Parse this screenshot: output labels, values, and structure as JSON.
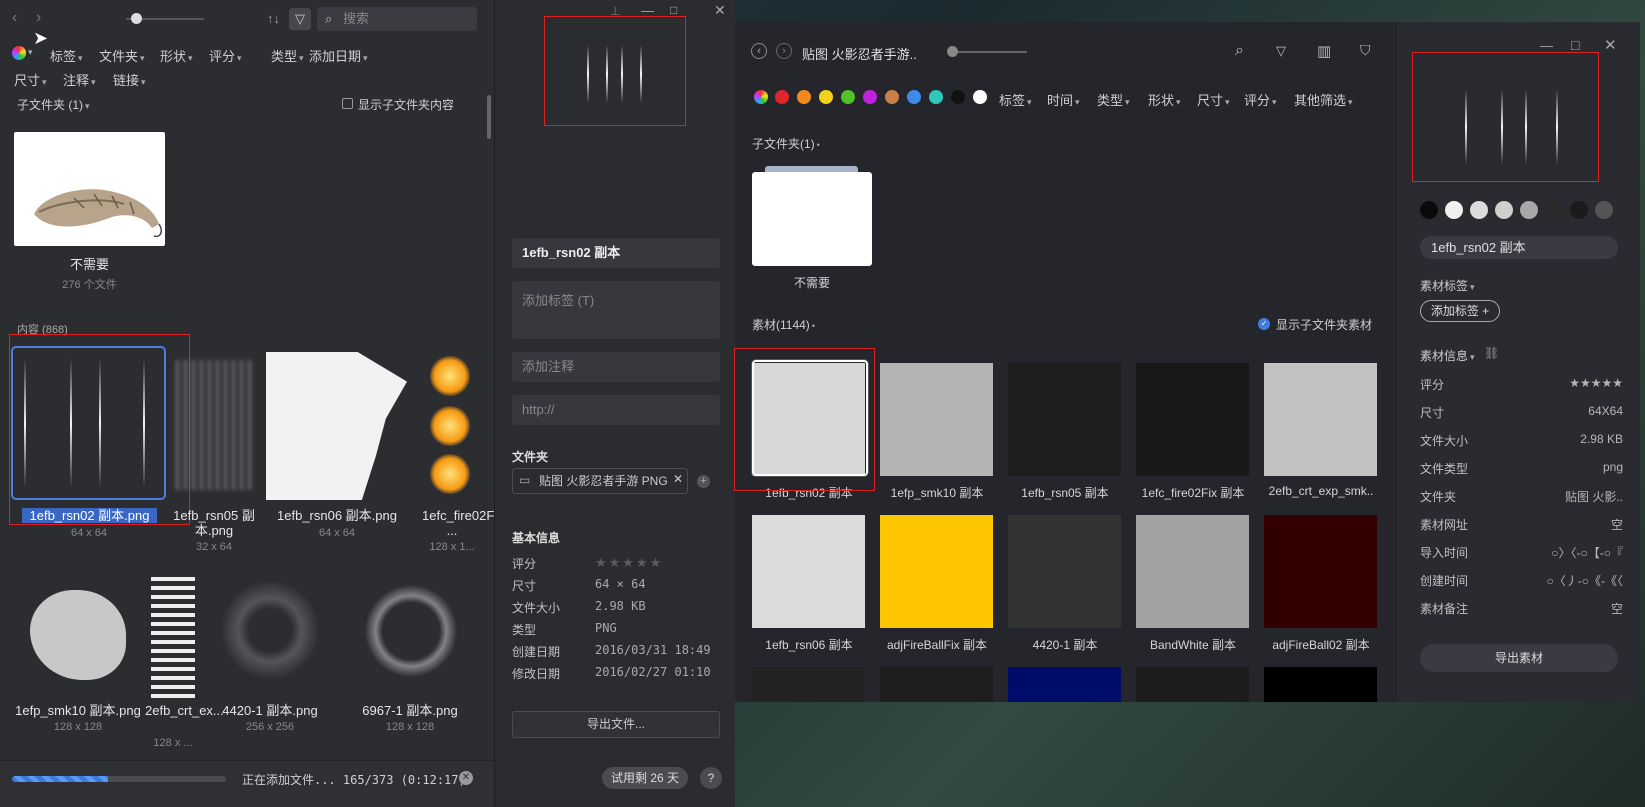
{
  "left_app": {
    "toolbar": {
      "back_icon": "chevron-left-icon",
      "forward_icon": "chevron-right-icon",
      "search_placeholder": "搜索"
    },
    "filters_row1": [
      "标签",
      "文件夹",
      "形状",
      "评分",
      "类型",
      "添加日期"
    ],
    "filters_row2": [
      "尺寸",
      "注释",
      "链接"
    ],
    "subfolder_header": "子文件夹 (1)",
    "show_subfolder_content": "显示子文件夹内容",
    "folder": {
      "name": "不需要",
      "count": "276 个文件"
    },
    "content_header": "内容 (868)",
    "items": [
      {
        "name": "1efb_rsn02 副本.png",
        "size": "64 x 64"
      },
      {
        "name": "1efb_rsn05 副本.png",
        "size": "32 x 64"
      },
      {
        "name": "1efb_rsn06 副本.png",
        "size": "64 x 64"
      },
      {
        "name": "1efc_fire02Fix ...",
        "size": "128 x 1..."
      },
      {
        "name": "1efp_smk10 副本.png",
        "size": "128 x 128"
      },
      {
        "name": "2efb_crt_ex...",
        "size": "128 x ..."
      },
      {
        "name": "4420-1 副本.png",
        "size": "256 x 256"
      },
      {
        "name": "6967-1 副本.png",
        "size": "128 x 128"
      }
    ],
    "status": {
      "text": "正在添加文件... 165/373 (0:12:17)",
      "progress": 0.45
    }
  },
  "detail": {
    "name": "1efb_rsn02 副本",
    "tag_placeholder": "添加标签 (T)",
    "note_placeholder": "添加注释",
    "url_placeholder": "http://",
    "folder_label": "文件夹",
    "folder_value": "贴图 火影忍者手游 PNG",
    "basic_info": "基本信息",
    "rows": [
      {
        "k": "评分",
        "v": ""
      },
      {
        "k": "尺寸",
        "v": "64 × 64"
      },
      {
        "k": "文件大小",
        "v": "2.98 KB"
      },
      {
        "k": "类型",
        "v": "PNG"
      },
      {
        "k": "创建日期",
        "v": "2016/03/31 18:49"
      },
      {
        "k": "修改日期",
        "v": "2016/02/27 01:10"
      }
    ],
    "export": "导出文件...",
    "trial": "试用剩 26 天",
    "help": "?"
  },
  "right_app": {
    "title": "贴图 火影忍者手游..",
    "filters": [
      "标签",
      "时间",
      "类型",
      "形状",
      "尺寸",
      "评分",
      "其他筛选"
    ],
    "colors": [
      "#e0262b",
      "#f08a1c",
      "#f0d21c",
      "#52c22a",
      "#c020e0",
      "#c8814a",
      "#3f8ae8",
      "#2fc8b8",
      "#111111",
      "#ffffff"
    ],
    "subfolder_header": "子文件夹(1)",
    "folder_name": "不需要",
    "materials_header": "素材(1144)",
    "show_sub_materials": "显示子文件夹素材",
    "tiles": [
      {
        "name": "1efb_rsn02 副本",
        "color": "#d8d8d8"
      },
      {
        "name": "1efp_smk10 副本",
        "color": "#b4b4b4"
      },
      {
        "name": "1efb_rsn05 副本",
        "color": "#1e1e1e"
      },
      {
        "name": "1efc_fire02Fix 副本",
        "color": "#181818"
      },
      {
        "name": "2efb_crt_exp_smk..",
        "color": "#c2c2c2"
      },
      {
        "name": "1efb_rsn06 副本",
        "color": "#dcdcdc"
      },
      {
        "name": "adjFireBallFix 副本",
        "color": "#fdc600"
      },
      {
        "name": "4420-1 副本",
        "color": "#333333"
      },
      {
        "name": "BandWhite 副本",
        "color": "#a2a2a2"
      },
      {
        "name": "adjFireBall02 副本",
        "color": "#330000"
      }
    ],
    "bottom_tiles": [
      "#222222",
      "#1e1e1e",
      "#000c6a",
      "#1c1c1c",
      "#000000"
    ]
  },
  "inspector": {
    "swatches": [
      "#0a0a0a",
      "#f0f0f0",
      "#dcdcdc",
      "#cfcfcf",
      "#a8a8a8",
      "#2a2a2a",
      "#1a1a1a",
      "#555555"
    ],
    "name": "1efb_rsn02 副本",
    "tags_label": "素材标签",
    "add_tag": "添加标签 +",
    "info_label": "素材信息",
    "rows": [
      {
        "k": "评分",
        "v": "★★★★★"
      },
      {
        "k": "尺寸",
        "v": "64X64"
      },
      {
        "k": "文件大小",
        "v": "2.98 KB"
      },
      {
        "k": "文件类型",
        "v": "png"
      },
      {
        "k": "文件夹",
        "v": "贴图 火影.."
      },
      {
        "k": "素材网址",
        "v": "空"
      },
      {
        "k": "导入时间",
        "v": "○〉〈-○【-○『"
      },
      {
        "k": "创建时间",
        "v": "○〈丿-○《-《〈"
      },
      {
        "k": "素材备注",
        "v": "空"
      }
    ],
    "export": "导出素材"
  }
}
